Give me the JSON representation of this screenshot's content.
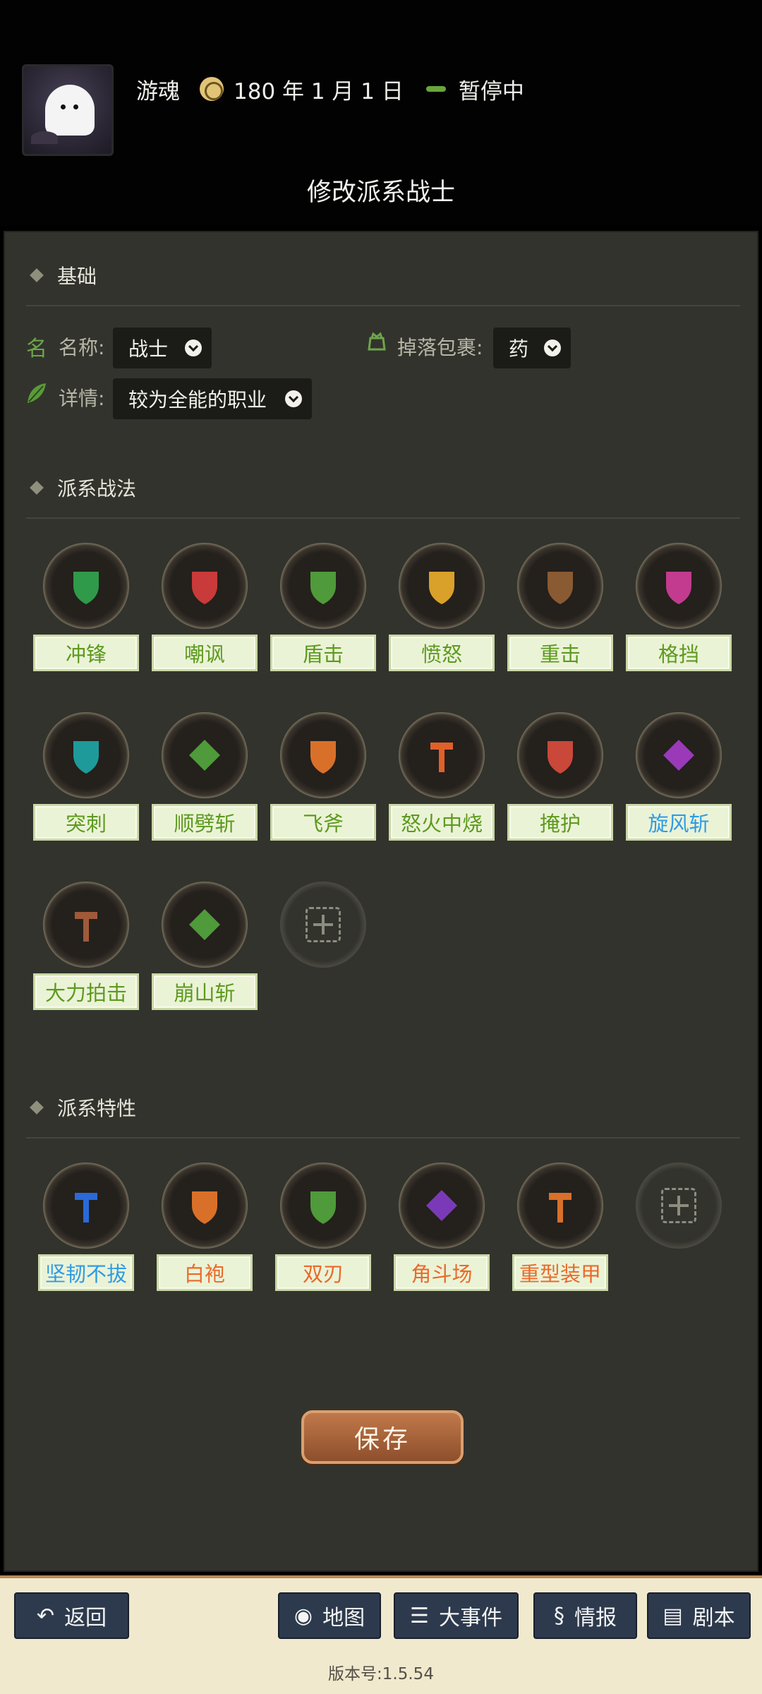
{
  "header": {
    "player_name": "游魂",
    "date": "180 年 1 月 1 日",
    "status": "暂停中",
    "page_title": "修改派系战士"
  },
  "basics": {
    "title": "基础",
    "name_label": "名称:",
    "name_icon": "名",
    "name_value": "战士",
    "loot_label": "掉落包裹:",
    "loot_value": "药",
    "detail_label": "详情:",
    "detail_value": "较为全能的职业"
  },
  "tactics": {
    "title": "派系战法",
    "items": [
      {
        "label": "冲锋",
        "icon": "arrow-rush-icon",
        "color": "#2f9a49"
      },
      {
        "label": "嘲讽",
        "icon": "roar-icon",
        "color": "#c93a3a"
      },
      {
        "label": "盾击",
        "icon": "shield-stack-icon",
        "color": "#4f9a3a"
      },
      {
        "label": "愤怒",
        "icon": "rage-face-icon",
        "color": "#d9a12a"
      },
      {
        "label": "重击",
        "icon": "hammer-icon",
        "color": "#8a5a32"
      },
      {
        "label": "格挡",
        "icon": "block-shield-icon",
        "color": "#c23b8e"
      },
      {
        "label": "突刺",
        "icon": "spear-icon",
        "color": "#1f9a9a"
      },
      {
        "label": "顺劈斩",
        "icon": "cleave-icon",
        "color": "#4f9a3a"
      },
      {
        "label": "飞斧",
        "icon": "flying-axe-icon",
        "color": "#d9702a"
      },
      {
        "label": "怒火中烧",
        "icon": "fire-rage-icon",
        "color": "#e0602a"
      },
      {
        "label": "掩护",
        "icon": "cover-icon",
        "color": "#c9483a"
      },
      {
        "label": "旋风斩",
        "icon": "whirlwind-icon",
        "color": "#9a3ab8"
      },
      {
        "label": "大力拍击",
        "icon": "round-shield-icon",
        "color": "#a05a3a"
      },
      {
        "label": "崩山斩",
        "icon": "mountain-slash-icon",
        "color": "#4f9a3a"
      }
    ]
  },
  "traits": {
    "title": "派系特性",
    "items": [
      {
        "label": "坚韧不拔",
        "icon": "fist-icon",
        "color": "#2a6ad9"
      },
      {
        "label": "白袍",
        "icon": "robe-icon",
        "color": "#d9702a"
      },
      {
        "label": "双刃",
        "icon": "crossed-swords-icon",
        "color": "#4f9a3a"
      },
      {
        "label": "角斗场",
        "icon": "arena-icon",
        "color": "#7a3ab8"
      },
      {
        "label": "重型装甲",
        "icon": "heavy-armor-icon",
        "color": "#d9702a"
      }
    ]
  },
  "save_label": "保存",
  "nav": {
    "back": "返回",
    "map": "地图",
    "events": "大事件",
    "intel": "情报",
    "script": "剧本"
  },
  "version": "版本号:1.5.54"
}
